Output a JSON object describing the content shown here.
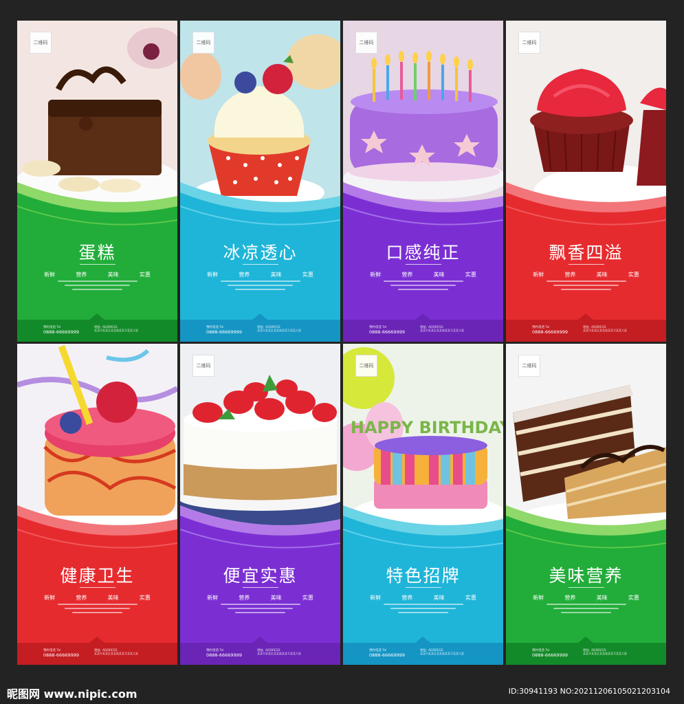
{
  "colors": {
    "green": "#22ad3a",
    "blue": "#1fb5d8",
    "purple": "#7b2fd3",
    "red": "#e62b2f"
  },
  "cards": [
    {
      "qr": "二维码",
      "title": "蛋糕",
      "tags": [
        "新鲜",
        "营养",
        "美味",
        "实惠"
      ],
      "addr_label": "地址: ADDRESS",
      "addr": "某某市某某区某某路某某号某某大厦",
      "tel_label": "预约电话 Tel",
      "phone": "0888-66669999",
      "theme": "green",
      "photo": "chocolate-brownie"
    },
    {
      "qr": "二维码",
      "title": "冰凉透心",
      "tags": [
        "新鲜",
        "营养",
        "美味",
        "实惠"
      ],
      "addr_label": "地址: ADDRESS",
      "addr": "某某市某某区某某路某某号某某大厦",
      "tel_label": "预约电话 Tel",
      "phone": "0888-66669999",
      "theme": "blue",
      "photo": "berry-cupcake"
    },
    {
      "qr": "二维码",
      "title": "口感纯正",
      "tags": [
        "新鲜",
        "营养",
        "美味",
        "实惠"
      ],
      "addr_label": "地址: ADDRESS",
      "addr": "某某市某某区某某路某某号某某大厦",
      "tel_label": "预约电话 Tel",
      "phone": "0888-66669999",
      "theme": "purple",
      "photo": "candle-cake"
    },
    {
      "qr": "二维码",
      "title": "飘香四溢",
      "tags": [
        "新鲜",
        "营养",
        "美味",
        "实惠"
      ],
      "addr_label": "地址: ADDRESS",
      "addr": "某某市某某区某某路某某号某某大厦",
      "tel_label": "预约电话 Tel",
      "phone": "0888-66669999",
      "theme": "red",
      "photo": "red-velvet-cupcake"
    },
    {
      "qr": "",
      "title": "健康卫生",
      "tags": [
        "新鲜",
        "营养",
        "美味",
        "实惠"
      ],
      "addr_label": "地址: ADDRESS",
      "addr": "某某市某某区某某路某某号某某大厦",
      "tel_label": "预约电话 Tel",
      "phone": "0888-66669999",
      "theme": "red",
      "photo": "raspberry-mousse"
    },
    {
      "qr": "二维码",
      "title": "便宜实惠",
      "tags": [
        "新鲜",
        "营养",
        "美味",
        "实惠"
      ],
      "addr_label": "地址: ADDRESS",
      "addr": "某某市某某区某某路某某号某某大厦",
      "tel_label": "预约电话 Tel",
      "phone": "0888-66669999",
      "theme": "purple",
      "photo": "strawberry-cheesecake"
    },
    {
      "qr": "二维码",
      "title": "特色招牌",
      "tags": [
        "新鲜",
        "营养",
        "美味",
        "实惠"
      ],
      "addr_label": "地址: ADDRESS",
      "addr": "某某市某某区某某路某某号某某大厦",
      "tel_label": "预约电话 Tel",
      "phone": "0888-66669999",
      "theme": "blue",
      "photo": "birthday-cake",
      "photo_text": "HAPPY BIRTHDAY"
    },
    {
      "qr": "二维码",
      "title": "美味营养",
      "tags": [
        "新鲜",
        "营养",
        "美味",
        "实惠"
      ],
      "addr_label": "地址: ADDRESS",
      "addr": "某某市某某区某某路某某号某某大厦",
      "tel_label": "预约电话 Tel",
      "phone": "0888-66669999",
      "theme": "green",
      "photo": "layer-cake-slice"
    }
  ],
  "watermark": {
    "left": "昵图网 www.nipic.com",
    "right": "ID:30941193 NO:20211206105021203104"
  }
}
